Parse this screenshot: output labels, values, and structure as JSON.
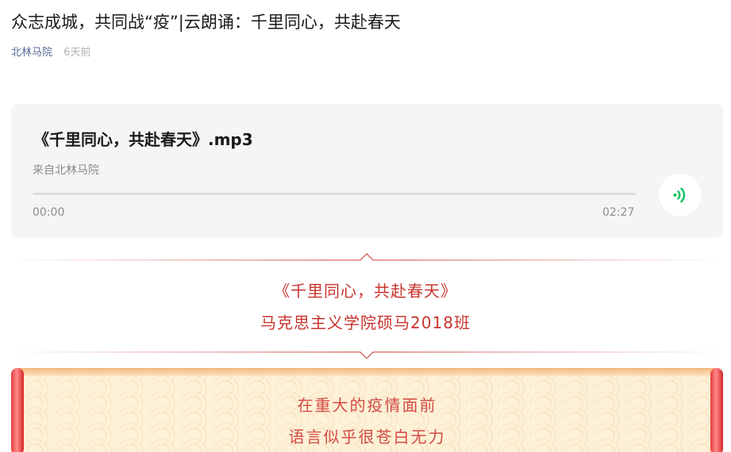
{
  "article": {
    "title": "众志成城，共同战“疫”|云朗诵：千里同心，共赴春天",
    "author": "北林马院",
    "time": "6天前"
  },
  "audio": {
    "title": "《千里同心，共赴春天》.mp3",
    "source": "来自北林马院",
    "current_time": "00:00",
    "duration": "02:27",
    "progress": 0,
    "accent_color": "#07c160",
    "play_icon": "audio-wave-icon"
  },
  "banner": {
    "line1": "《千里同心，共赴春天》",
    "line2": "马克思主义学院硕马2018班",
    "color": "#c8332d"
  },
  "poem": {
    "line1": "在重大的疫情面前",
    "line2": "语言似乎很苍白无力",
    "color": "#d24b43"
  }
}
